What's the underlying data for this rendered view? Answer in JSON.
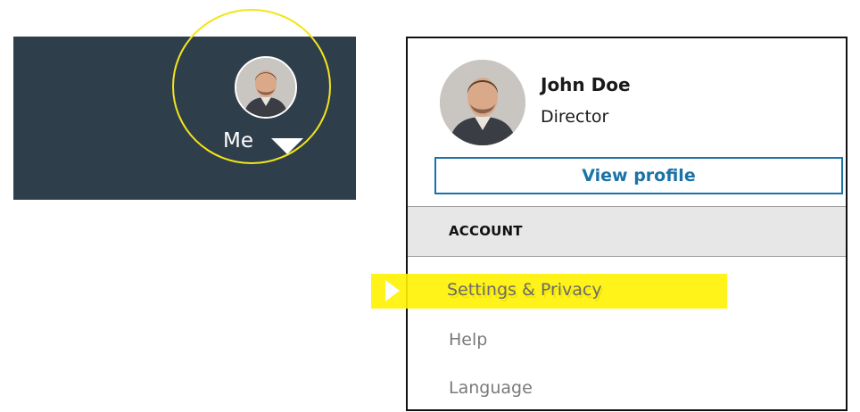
{
  "navbar": {
    "me_label": "Me",
    "avatar_icon": "avatar-photo",
    "caret_icon": "caret-down-icon"
  },
  "profile": {
    "name": "John Doe",
    "title": "Director",
    "view_profile_label": "View profile"
  },
  "menu": {
    "section_header": "ACCOUNT",
    "items": [
      {
        "label": "Settings & Privacy"
      },
      {
        "label": "Help"
      },
      {
        "label": "Language"
      }
    ]
  },
  "colors": {
    "navbar_bg": "#2f3e4b",
    "accent_blue": "#1a73a8",
    "highlight_yellow": "#fff200",
    "spotlight_yellow": "#f2e51a",
    "section_bg": "#e7e7e7"
  }
}
